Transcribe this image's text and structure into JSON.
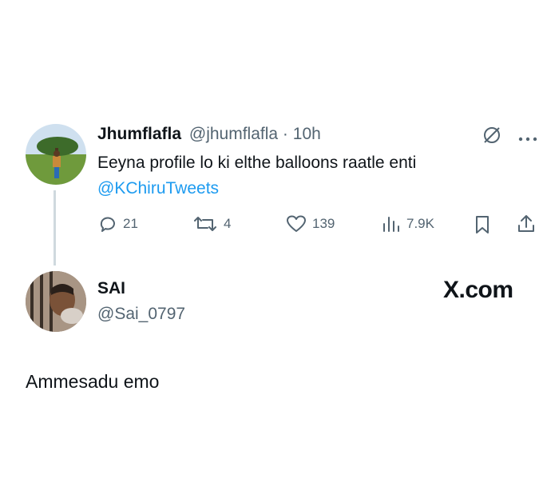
{
  "parent_tweet": {
    "display_name": "Jhumflafla",
    "handle": "@jhumflafla",
    "separator": "·",
    "time": "10h",
    "text": "Eeyna profile lo ki elthe balloons raatle enti",
    "mention": "@KChiruTweets",
    "stats": {
      "replies": "21",
      "retweets": "4",
      "likes": "139",
      "views": "7.9K"
    },
    "icons": [
      "grok-icon",
      "more-icon",
      "reply-icon",
      "retweet-icon",
      "like-icon",
      "views-icon",
      "bookmark-icon",
      "share-icon"
    ]
  },
  "reply": {
    "display_name": "SAI",
    "handle": "@Sai_0797",
    "text": "Ammesadu emo",
    "watermark": "X.com"
  }
}
